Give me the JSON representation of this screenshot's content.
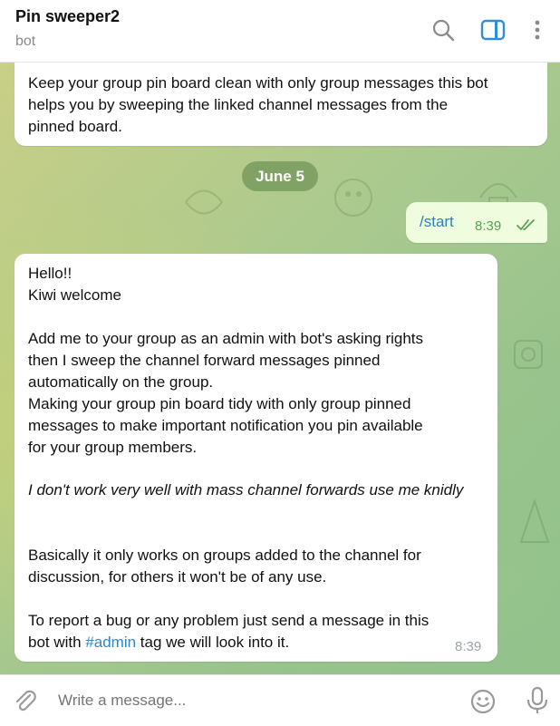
{
  "header": {
    "title": "Pin sweeper2",
    "subtitle": "bot",
    "icons": [
      "search-icon",
      "sidebar-toggle-icon",
      "more-vert-icon"
    ],
    "accent": "#2f8fd6"
  },
  "messages": {
    "top": {
      "lines": [
        "Keep your group pin board clean with only group messages this bot",
        "helps you by sweeping the linked channel messages from the",
        "pinned board."
      ]
    },
    "date_label": "June 5",
    "outgoing": {
      "text": "/start",
      "time": "8:39"
    },
    "main": {
      "greeting": "Hello!!",
      "welcome": "Kiwi welcome",
      "p1": [
        " Add me to your group as an admin with bot's asking rights",
        " then I sweep the channel forward messages pinned",
        "automatically on the group.",
        " Making your group pin board tidy with only group pinned",
        "messages to make important notification you pin available",
        "for your group members."
      ],
      "italic_note": " I don't work very well with mass channel forwards use me knidly",
      "p2": [
        " Basically it only works on groups added to the channel for",
        "discussion, for others it won't be of any use."
      ],
      "p3_line1": " To report a bug or any problem just send a message in this",
      "p3_line2_before": "bot with ",
      "p3_tag": "#admin",
      "p3_line2_after": " tag we will look into it.",
      "time": "8:39"
    }
  },
  "input": {
    "placeholder": "Write a message...",
    "icons": [
      "attach-icon",
      "emoji-icon",
      "mic-icon"
    ]
  },
  "colors": {
    "outgoing_bubble": "#effdde",
    "link": "#2f86c9",
    "check": "#5aa053"
  }
}
